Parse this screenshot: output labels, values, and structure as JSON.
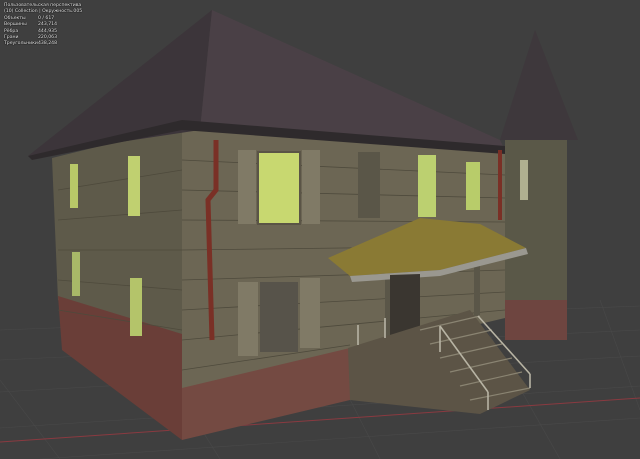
{
  "overlay": {
    "view_name": "Пользовательская перспектива",
    "collection": "(10) Collection | Окружность.005",
    "stats": [
      {
        "label": "Объекты",
        "value": "0 / 617"
      },
      {
        "label": "Вершины",
        "value": "243,714"
      },
      {
        "label": "Рёбра",
        "value": "444,935"
      },
      {
        "label": "Грани",
        "value": "220,063"
      },
      {
        "label": "Треугольники",
        "value": "438,248"
      }
    ]
  },
  "colors": {
    "viewport_bg": "#3f3f3f",
    "grid_line": "#4a4a4a",
    "x_axis": "#8a3a40",
    "roof": "#4a4046",
    "walls": "#6a6452",
    "bricks": "#7a4c44",
    "windows": "#c8d870",
    "moss": "#8a7a34",
    "drainpipe": "#7a3026"
  },
  "scene": {
    "object": "house-model"
  }
}
